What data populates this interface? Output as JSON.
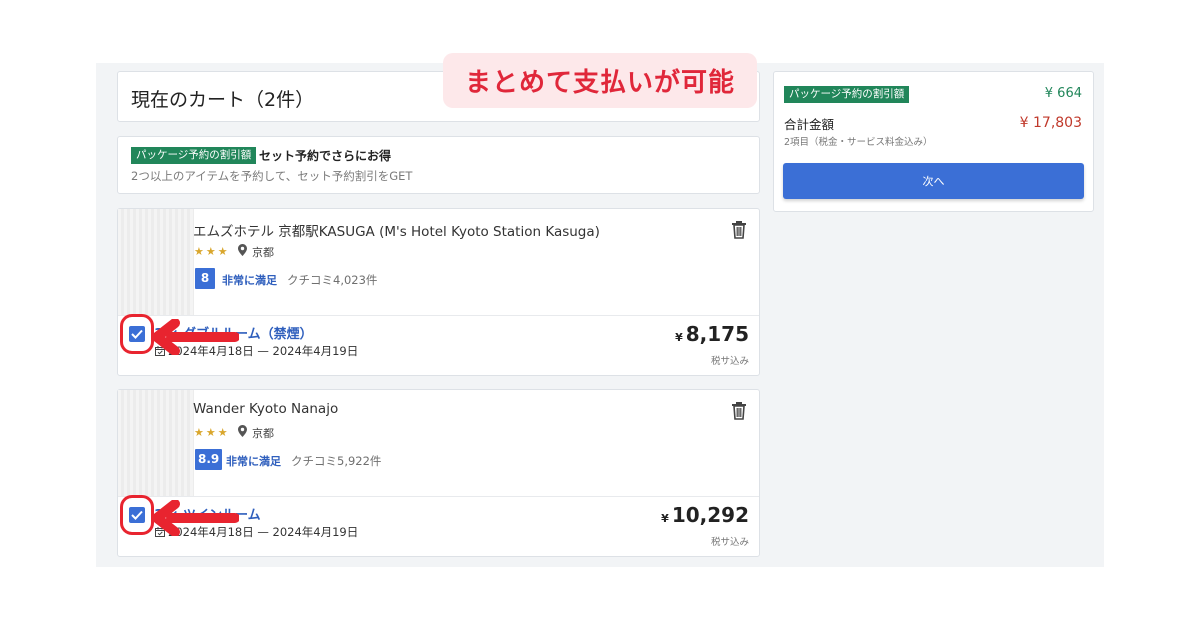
{
  "cart": {
    "title": "現在のカート（2件）"
  },
  "callout": {
    "text": "まとめて支払いが可能"
  },
  "discount_banner": {
    "badge": "パッケージ予約の割引額",
    "title": "セット予約でさらにお得",
    "subtitle": "2つ以上のアイテムを予約して、セット予約割引をGET"
  },
  "hotels": [
    {
      "name": "エムズホテル 京都駅KASUGA (M's Hotel Kyoto Station Kasuga)",
      "stars": "★★★",
      "star_count": 3,
      "location": "京都",
      "score": "8",
      "score_label": "非常に満足",
      "reviews": "クチコミ4,023件",
      "room": "1 × ダブルルーム（禁煙）",
      "dates": "2024年4月18日 — 2024年4月19日",
      "currency": "¥",
      "price": "8,175",
      "tax_note": "税サ込み",
      "checked": true
    },
    {
      "name": "Wander Kyoto Nanajo",
      "stars": "★★★",
      "star_count": 3,
      "location": "京都",
      "score": "8.9",
      "score_label": "非常に満足",
      "reviews": "クチコミ5,922件",
      "room": "1 × ツインルーム",
      "dates": "2024年4月18日 — 2024年4月19日",
      "currency": "¥",
      "price": "10,292",
      "tax_note": "税サ込み",
      "checked": true
    }
  ],
  "summary": {
    "discount_badge": "パッケージ予約の割引額",
    "discount_amount": "¥ 664",
    "total_label": "合計金額",
    "total_amount": "¥ 17,803",
    "total_sub": "2項目（税金・サービス料金込み）",
    "next_button": "次へ"
  },
  "icons": {
    "trash": "trash-icon",
    "location": "location-pin-icon",
    "calendar": "calendar-icon",
    "check": "checkmark-icon",
    "arrow": "red-arrow-icon"
  },
  "colors": {
    "accent_blue": "#3b6fd6",
    "badge_green": "#21865a",
    "price_red": "#c0392b",
    "callout_red": "#e0273a",
    "callout_bg": "#fde8ea",
    "star_gold": "#d9a62c"
  }
}
